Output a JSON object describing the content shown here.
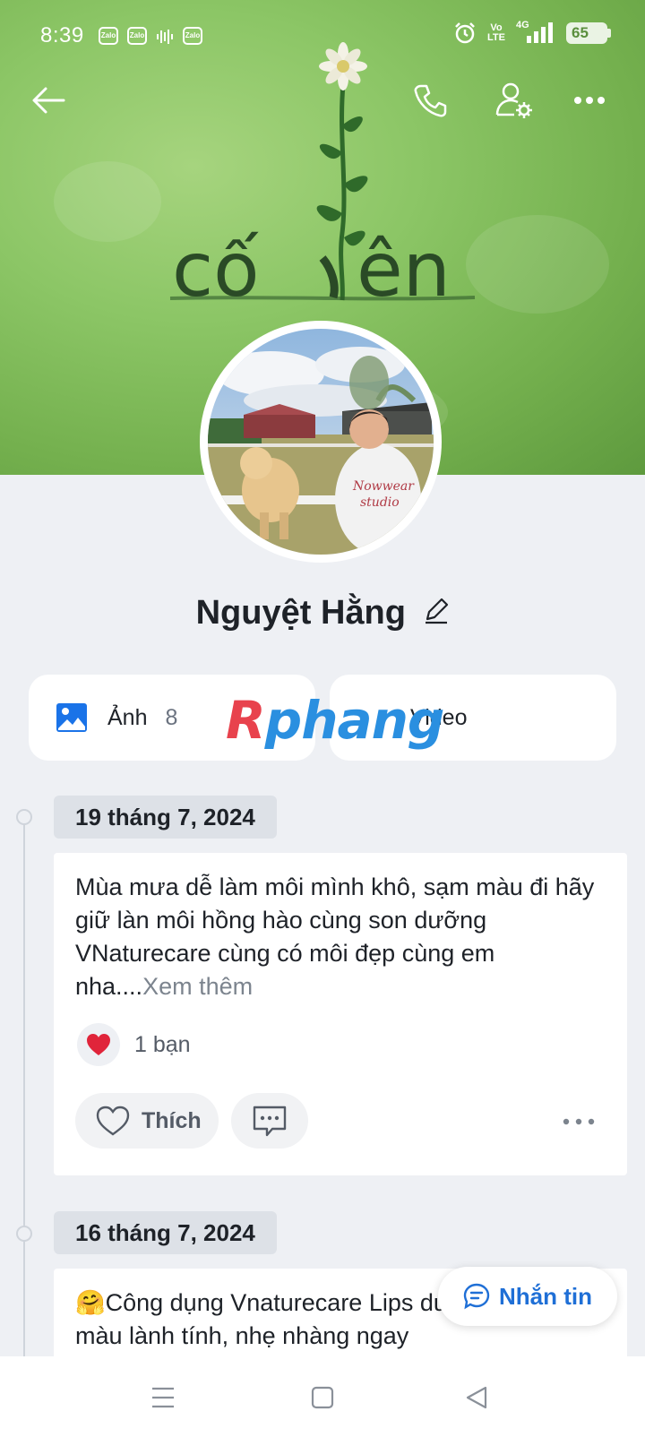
{
  "status_bar": {
    "time": "8:39",
    "notif_app": "Zalo",
    "network": "4G",
    "volte_top": "Vo",
    "volte_bottom": "LTE",
    "battery": "65"
  },
  "cover": {
    "text_left": "cố",
    "text_right": "ên"
  },
  "top_nav": {
    "back_icon": "arrow-left-icon",
    "call_icon": "phone-icon",
    "settings_icon": "user-settings-icon",
    "more_icon": "more-horizontal-icon"
  },
  "profile": {
    "name": "Nguyệt Hằng",
    "edit_icon": "pencil-icon"
  },
  "media": {
    "photos_label": "Ảnh",
    "photos_count": "8",
    "video_label": "Video"
  },
  "watermark": {
    "r": "R",
    "rest": "phang"
  },
  "posts": [
    {
      "date": "19 tháng 7, 2024",
      "text": "Mùa mưa dễ làm môi mình khô, sạm màu đi hãy giữ làn môi hồng hào cùng son dưỡng VNaturecare cùng có môi đẹp cùng em nha....",
      "see_more": "Xem thêm",
      "reactions": "1 bạn",
      "like_label": "Thích"
    },
    {
      "date": "16 tháng 7, 2024",
      "text": "🤗Công dụng Vnaturecare Lips dưỡng không màu lành tính, nhẹ nhàng ngay"
    }
  ],
  "message_button": {
    "label": "Nhắn tin"
  },
  "colors": {
    "accent": "#1f6fd6",
    "heart": "#e0243a",
    "cover_green": "#8cc666"
  }
}
